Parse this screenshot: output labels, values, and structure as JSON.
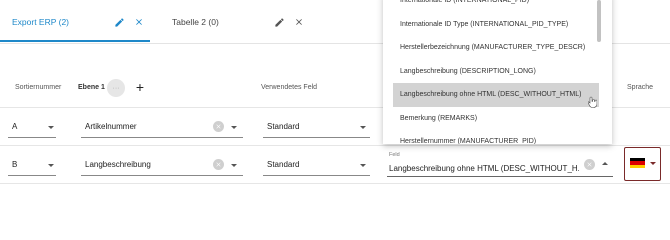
{
  "tabs": [
    {
      "label": "Export ERP (2)",
      "active": true
    },
    {
      "label": "Tabelle 2 (0)",
      "active": false
    }
  ],
  "header": {
    "sortiernummer": "Sortiernummer",
    "ebene1": "Ebene 1",
    "ebene_badge": "···",
    "verwendetes_feld": "Verwendetes Feld",
    "sprache": "Sprache"
  },
  "rows": [
    {
      "sort": "A",
      "field": "Artikelnummer",
      "usage": "Standard"
    },
    {
      "sort": "B",
      "field": "Langbeschreibung",
      "usage": "Standard"
    }
  ],
  "feld": {
    "label": "Feld",
    "value": "Langbeschreibung ohne HTML (DESC_WITHOUT_H..."
  },
  "dropdown": {
    "items": [
      "Internationale ID (INTERNATIONAL_PID)",
      "Internationale ID Type (INTERNATIONAL_PID_TYPE)",
      "Herstellerbezeichnung (MANUFACTURER_TYPE_DESCR)",
      "Langbeschreibung (DESCRIPTION_LONG)",
      "Langbeschreibung ohne HTML (DESC_WITHOUT_HTML)",
      "Bemerkung (REMARKS)",
      "Herstellernummer (MANUFACTURER_PID)"
    ],
    "selected_index": 4
  },
  "colors": {
    "accent": "#1e88c9",
    "flag": [
      "#000000",
      "#dd0000",
      "#ffce00"
    ],
    "flag_border": "#7a2a2a"
  },
  "icons": {
    "edit": "pencil-icon",
    "close": "close-icon",
    "add": "plus-icon",
    "clear": "clear-icon",
    "dropdown": "caret-down-icon"
  }
}
